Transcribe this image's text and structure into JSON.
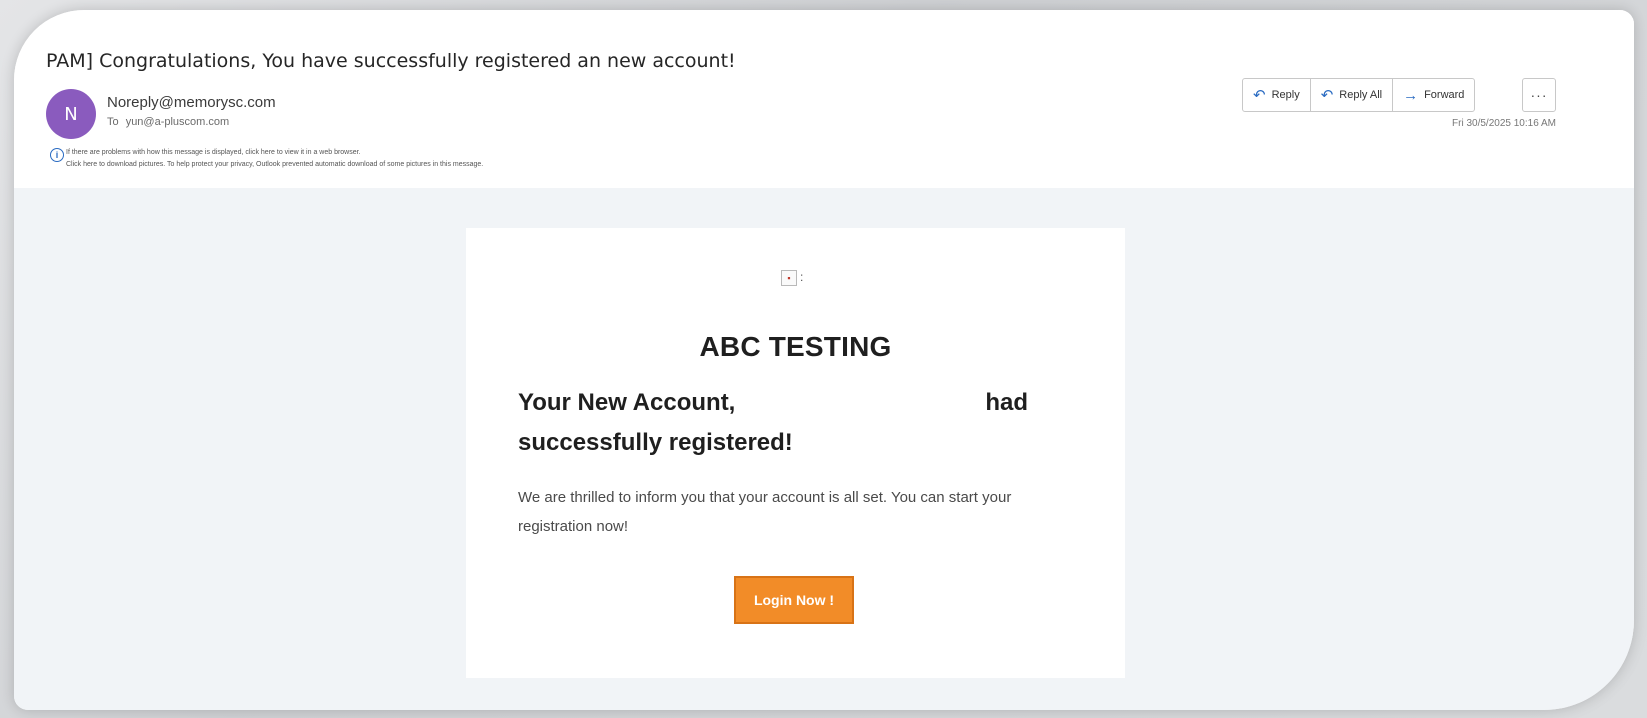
{
  "email": {
    "subject": "PAM]  Congratulations, You have successfully registered an new account!",
    "avatar_initial": "N",
    "sender": "Noreply@memorysc.com",
    "to_label": "To",
    "to_value": "yun@a-pluscom.com",
    "info_line1": "If there are problems with how this message is displayed, click here to view it in a web browser.",
    "info_line2": "Click here to download pictures. To help protect your privacy, Outlook prevented automatic download of some pictures in this message.",
    "date": "Fri 30/5/2025 10:16 AM"
  },
  "actions": {
    "reply": "Reply",
    "reply_all": "Reply All",
    "forward": "Forward",
    "more": "···"
  },
  "message": {
    "brand": "ABC TESTING",
    "headline_part1": "Your New Account,",
    "headline_part2": "had",
    "headline_part3": "successfully registered!",
    "paragraph": "We are thrilled to inform you that your account is all set. You can start your registration now!",
    "login_button": "Login Now !"
  },
  "colors": {
    "avatar": "#8a5bbe",
    "accent": "#2a6bc2",
    "login_button": "#f28c28",
    "body_background": "#f1f4f7"
  },
  "icons": {
    "reply": "reply-arrow-icon",
    "reply_all": "reply-all-arrow-icon",
    "forward": "forward-arrow-icon",
    "info": "info-icon",
    "broken_image": "broken-image-icon"
  }
}
